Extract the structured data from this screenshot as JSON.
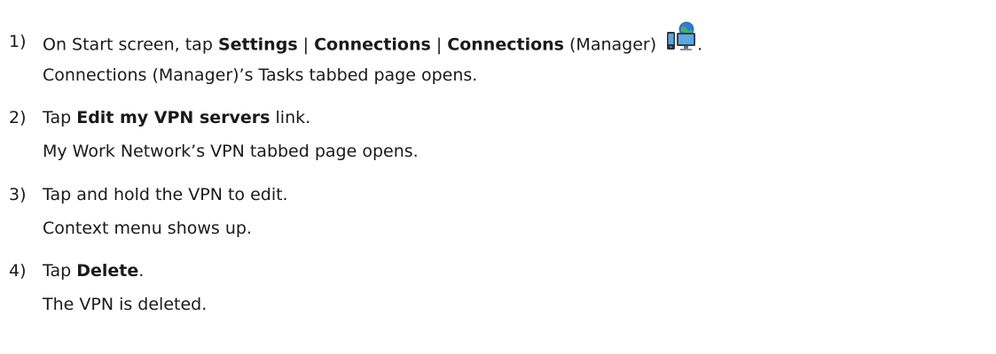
{
  "steps": [
    {
      "number": "1)",
      "instruction_parts": [
        "On Start screen, tap ",
        "Settings",
        " | ",
        "Connections",
        " | ",
        "Connections",
        " (Manager) ",
        "."
      ],
      "icon": "connections-manager-icon",
      "result": "Connections (Manager)’s Tasks tabbed page opens."
    },
    {
      "number": "2)",
      "instruction_parts": [
        "Tap ",
        "Edit my VPN servers",
        " link."
      ],
      "result": "My Work Network’s VPN tabbed page opens."
    },
    {
      "number": "3)",
      "instruction_parts": [
        "Tap and hold the VPN to edit."
      ],
      "result": "Context menu shows up."
    },
    {
      "number": "4)",
      "instruction_parts": [
        "Tap ",
        "Delete",
        "."
      ],
      "result": "The VPN is deleted."
    }
  ],
  "colors": {
    "text": "#1a1a1a",
    "icon_blue": "#2a7fd4",
    "icon_green": "#4caf50"
  }
}
